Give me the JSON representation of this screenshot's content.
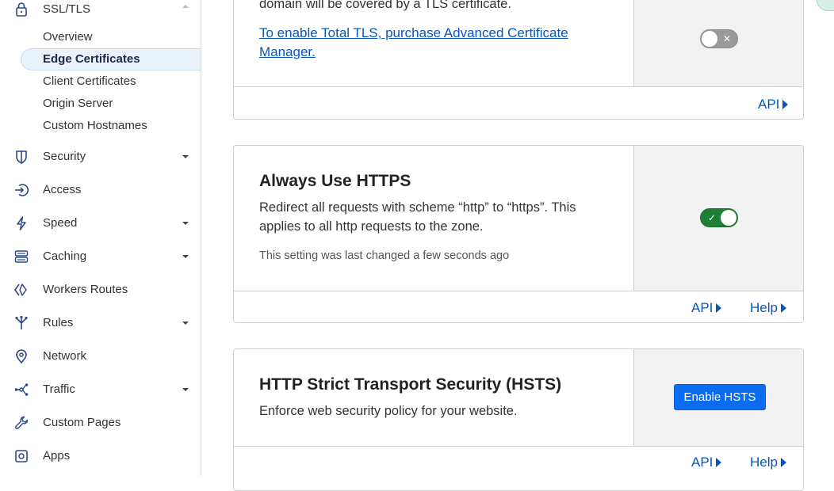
{
  "sidebar": {
    "section": {
      "label": "SSL/TLS",
      "icon": "lock-icon"
    },
    "sub_items": [
      {
        "label": "Overview",
        "active": false
      },
      {
        "label": "Edge Certificates",
        "active": true
      },
      {
        "label": "Client Certificates",
        "active": false
      },
      {
        "label": "Origin Server",
        "active": false
      },
      {
        "label": "Custom Hostnames",
        "active": false
      }
    ],
    "items": [
      {
        "label": "Security",
        "icon": "shield-icon",
        "expandable": true
      },
      {
        "label": "Access",
        "icon": "access-icon",
        "expandable": false
      },
      {
        "label": "Speed",
        "icon": "lightning-icon",
        "expandable": true
      },
      {
        "label": "Caching",
        "icon": "caching-icon",
        "expandable": true
      },
      {
        "label": "Workers Routes",
        "icon": "workers-icon",
        "expandable": false
      },
      {
        "label": "Rules",
        "icon": "rules-icon",
        "expandable": true
      },
      {
        "label": "Network",
        "icon": "location-pin-icon",
        "expandable": false
      },
      {
        "label": "Traffic",
        "icon": "traffic-icon",
        "expandable": true
      },
      {
        "label": "Custom Pages",
        "icon": "wrench-icon",
        "expandable": false
      },
      {
        "label": "Apps",
        "icon": "apps-icon",
        "expandable": false
      }
    ]
  },
  "cards": {
    "total_tls": {
      "desc_tail": "domain will be covered by a TLS certificate.",
      "link": "To enable Total TLS, purchase Advanced Certificate Manager.",
      "toggle_on": false,
      "api_label": "API"
    },
    "always_https": {
      "title": "Always Use HTTPS",
      "description": "Redirect all requests with scheme “http” to “https”. This applies to all http requests to the zone.",
      "meta": "This setting was last changed a few seconds ago",
      "toggle_on": true,
      "api_label": "API",
      "help_label": "Help"
    },
    "hsts": {
      "title": "HTTP Strict Transport Security (HSTS)",
      "description": "Enforce web security policy for your website.",
      "button_label": "Enable HSTS",
      "api_label": "API",
      "help_label": "Help"
    }
  },
  "colors": {
    "link": "#0a55b8",
    "toggle_on": "#1e7e34",
    "toggle_off": "#9a9a9a",
    "primary_button": "#0a6cf0",
    "active_nav_bg": "#eaf2fb"
  }
}
